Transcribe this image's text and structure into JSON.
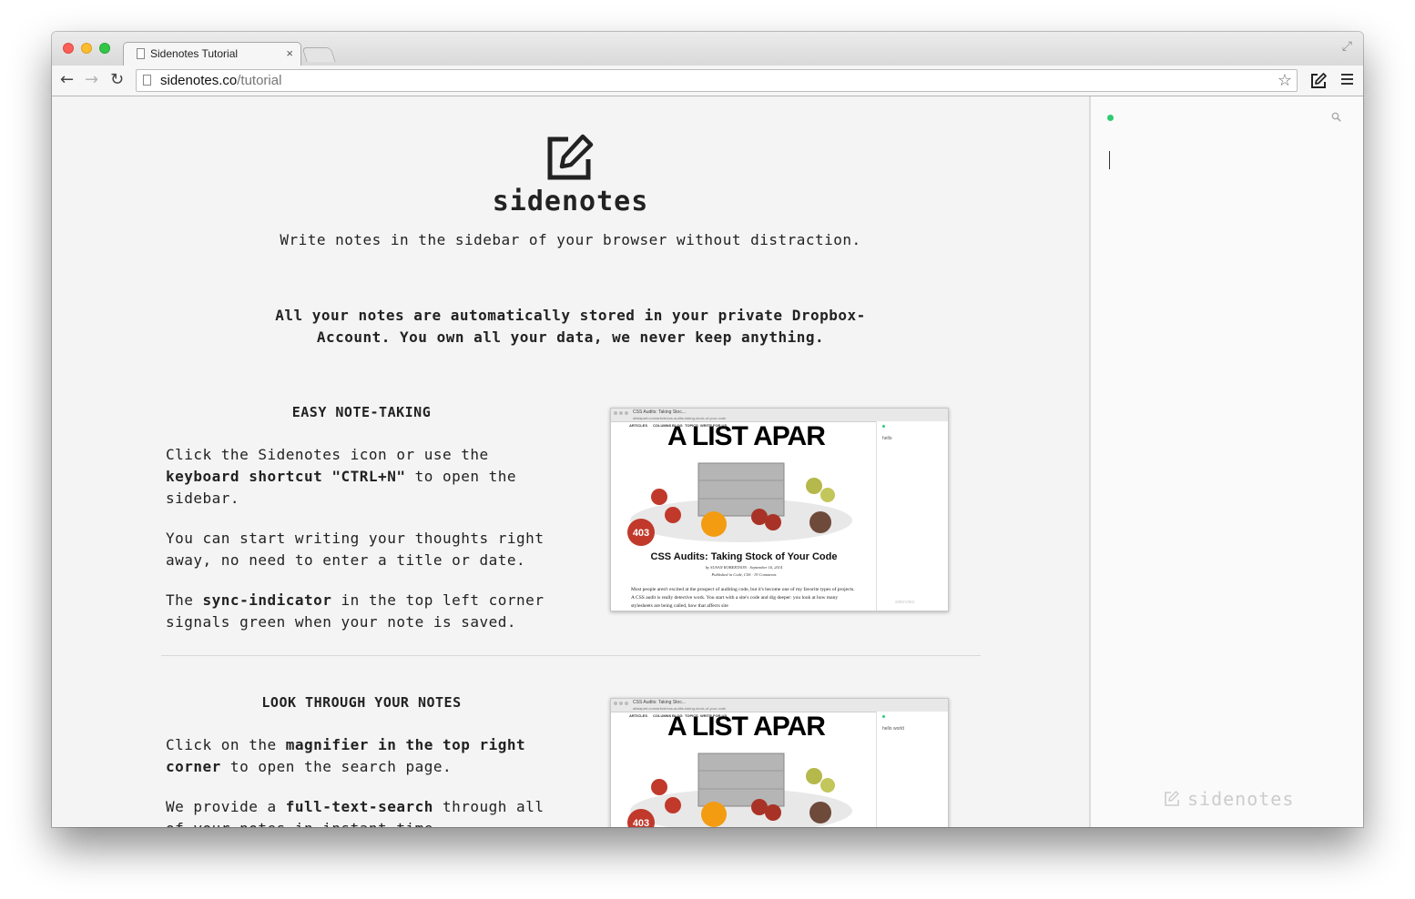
{
  "browser": {
    "tab_title": "Sidenotes Tutorial",
    "tab_close": "×",
    "url_host": "sidenotes.co",
    "url_path": "/tutorial",
    "back_glyph": "←",
    "forward_glyph": "→",
    "reload_glyph": "↻",
    "star_glyph": "☆",
    "fullscreen_glyph": "⤢"
  },
  "hero": {
    "brand": "sidenotes",
    "tagline": "Write notes in the sidebar of your browser without distraction.",
    "note": "All your notes are automatically stored in your private Dropbox-Account. You own all your data, we never keep anything."
  },
  "sections": [
    {
      "heading": "EASY NOTE-TAKING",
      "p1": [
        "Click the Sidenotes icon or use the ",
        "keyboard shortcut \"CTRL+N\"",
        " to open the sidebar."
      ],
      "p2": "You can start writing your thoughts right away, no need to enter a title or date.",
      "p3": [
        "The ",
        "sync-indicator",
        " in the top left corner signals green when your note is saved."
      ]
    },
    {
      "heading": "LOOK THROUGH YOUR NOTES",
      "p1": [
        "Click on the ",
        "magnifier in the top right corner",
        " to open the search page."
      ],
      "p2": [
        "We provide a ",
        "full-text-search",
        " through all of your notes in instant time."
      ]
    }
  ],
  "screenshots": [
    {
      "tab": "CSS Audits: Taking Stoc...",
      "url": "alistapart.com/article/css-audits-taking-stock-of-your-code",
      "nav": [
        "ARTICLES",
        "COLUMNS",
        "BLOG",
        "TOPICS",
        "WRITE FOR US"
      ],
      "masthead": "A LIST APAR",
      "issue": "403",
      "article_title": "CSS Audits: Taking Stock of Your Code",
      "byline": "by SUSAN ROBERTSON · September 16, 2014",
      "published": "Published in Code, CSS · 19 Comments",
      "body": "Most people aren't excited at the prospect of auditing code, but it's become one of my favorite types of projects. A CSS audit is really detective work. You start with a site's code and dig deeper: you look at how many stylesheets are being called, how that affects site",
      "sidebar_text": "hello",
      "sidebar_brand": "sidenotes"
    },
    {
      "tab": "CSS Audits: Taking Stoc...",
      "url": "alistapart.com/article/css-audits-taking-stock-of-your-code",
      "nav": [
        "ARTICLES",
        "COLUMNS",
        "BLOG",
        "TOPICS",
        "WRITE FOR US"
      ],
      "masthead": "A LIST APAR",
      "issue": "403",
      "sidebar_text": "hello world"
    }
  ],
  "sidebar": {
    "brand": "sidenotes",
    "sync_color": "#2ecc71"
  }
}
